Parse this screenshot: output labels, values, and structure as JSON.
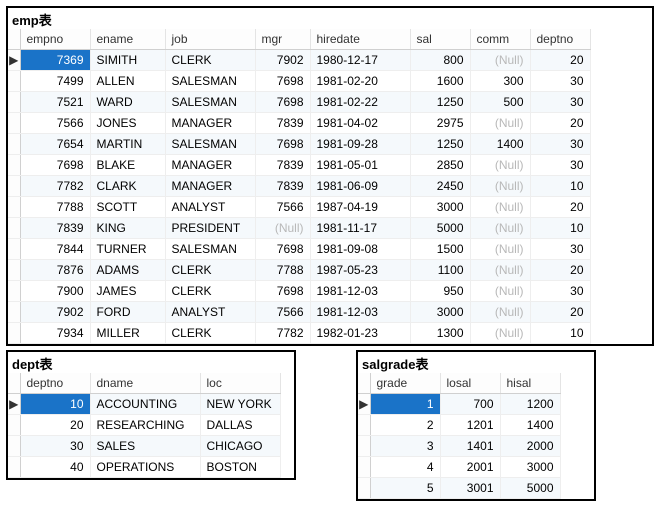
{
  "null_text": "(Null)",
  "emp": {
    "title": "emp表",
    "columns": [
      "empno",
      "ename",
      "job",
      "mgr",
      "hiredate",
      "sal",
      "comm",
      "deptno"
    ],
    "rows": [
      {
        "empno": 7369,
        "ename": "SIMITH",
        "job": "CLERK",
        "mgr": 7902,
        "hiredate": "1980-12-17",
        "sal": 800,
        "comm": null,
        "deptno": 20
      },
      {
        "empno": 7499,
        "ename": "ALLEN",
        "job": "SALESMAN",
        "mgr": 7698,
        "hiredate": "1981-02-20",
        "sal": 1600,
        "comm": 300,
        "deptno": 30
      },
      {
        "empno": 7521,
        "ename": "WARD",
        "job": "SALESMAN",
        "mgr": 7698,
        "hiredate": "1981-02-22",
        "sal": 1250,
        "comm": 500,
        "deptno": 30
      },
      {
        "empno": 7566,
        "ename": "JONES",
        "job": "MANAGER",
        "mgr": 7839,
        "hiredate": "1981-04-02",
        "sal": 2975,
        "comm": null,
        "deptno": 20
      },
      {
        "empno": 7654,
        "ename": "MARTIN",
        "job": "SALESMAN",
        "mgr": 7698,
        "hiredate": "1981-09-28",
        "sal": 1250,
        "comm": 1400,
        "deptno": 30
      },
      {
        "empno": 7698,
        "ename": "BLAKE",
        "job": "MANAGER",
        "mgr": 7839,
        "hiredate": "1981-05-01",
        "sal": 2850,
        "comm": null,
        "deptno": 30
      },
      {
        "empno": 7782,
        "ename": "CLARK",
        "job": "MANAGER",
        "mgr": 7839,
        "hiredate": "1981-06-09",
        "sal": 2450,
        "comm": null,
        "deptno": 10
      },
      {
        "empno": 7788,
        "ename": "SCOTT",
        "job": "ANALYST",
        "mgr": 7566,
        "hiredate": "1987-04-19",
        "sal": 3000,
        "comm": null,
        "deptno": 20
      },
      {
        "empno": 7839,
        "ename": "KING",
        "job": "PRESIDENT",
        "mgr": null,
        "hiredate": "1981-11-17",
        "sal": 5000,
        "comm": null,
        "deptno": 10
      },
      {
        "empno": 7844,
        "ename": "TURNER",
        "job": "SALESMAN",
        "mgr": 7698,
        "hiredate": "1981-09-08",
        "sal": 1500,
        "comm": null,
        "deptno": 30
      },
      {
        "empno": 7876,
        "ename": "ADAMS",
        "job": "CLERK",
        "mgr": 7788,
        "hiredate": "1987-05-23",
        "sal": 1100,
        "comm": null,
        "deptno": 20
      },
      {
        "empno": 7900,
        "ename": "JAMES",
        "job": "CLERK",
        "mgr": 7698,
        "hiredate": "1981-12-03",
        "sal": 950,
        "comm": null,
        "deptno": 30
      },
      {
        "empno": 7902,
        "ename": "FORD",
        "job": "ANALYST",
        "mgr": 7566,
        "hiredate": "1981-12-03",
        "sal": 3000,
        "comm": null,
        "deptno": 20
      },
      {
        "empno": 7934,
        "ename": "MILLER",
        "job": "CLERK",
        "mgr": 7782,
        "hiredate": "1982-01-23",
        "sal": 1300,
        "comm": null,
        "deptno": 10
      }
    ],
    "numeric_cols": [
      "empno",
      "mgr",
      "sal",
      "comm",
      "deptno"
    ],
    "selected_row": 0,
    "selected_col": "empno"
  },
  "dept": {
    "title": "dept表",
    "columns": [
      "deptno",
      "dname",
      "loc"
    ],
    "rows": [
      {
        "deptno": 10,
        "dname": "ACCOUNTING",
        "loc": "NEW YORK"
      },
      {
        "deptno": 20,
        "dname": "RESEARCHING",
        "loc": "DALLAS"
      },
      {
        "deptno": 30,
        "dname": "SALES",
        "loc": "CHICAGO"
      },
      {
        "deptno": 40,
        "dname": "OPERATIONS",
        "loc": "BOSTON"
      }
    ],
    "numeric_cols": [
      "deptno"
    ],
    "selected_row": 0,
    "selected_col": "deptno"
  },
  "salgrade": {
    "title": "salgrade表",
    "columns": [
      "grade",
      "losal",
      "hisal"
    ],
    "rows": [
      {
        "grade": 1,
        "losal": 700,
        "hisal": 1200
      },
      {
        "grade": 2,
        "losal": 1201,
        "hisal": 1400
      },
      {
        "grade": 3,
        "losal": 1401,
        "hisal": 2000
      },
      {
        "grade": 4,
        "losal": 2001,
        "hisal": 3000
      },
      {
        "grade": 5,
        "losal": 3001,
        "hisal": 5000
      }
    ],
    "numeric_cols": [
      "grade",
      "losal",
      "hisal"
    ],
    "selected_row": 0,
    "selected_col": "grade"
  }
}
